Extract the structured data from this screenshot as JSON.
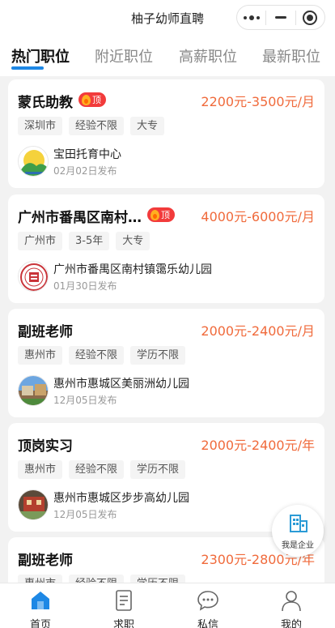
{
  "header": {
    "app_title": "柚子幼师直聘"
  },
  "tabs": [
    {
      "label": "热门职位",
      "active": true
    },
    {
      "label": "附近职位",
      "active": false
    },
    {
      "label": "高薪职位",
      "active": false
    },
    {
      "label": "最新职位",
      "active": false
    }
  ],
  "jobs": [
    {
      "title": "蒙氏助教",
      "badge": "顶",
      "salary": "2200元-3500元/月",
      "tags": [
        "深圳市",
        "经验不限",
        "大专"
      ],
      "company": "宝田托育中心",
      "posted": "02月02日发布"
    },
    {
      "title": "广州市番禺区南村…",
      "badge": "顶",
      "salary": "4000元-6000元/月",
      "tags": [
        "广州市",
        "3-5年",
        "大专"
      ],
      "company": "广州市番禺区南村镇霭乐幼儿园",
      "posted": "01月30日发布"
    },
    {
      "title": "副班老师",
      "badge": "",
      "salary": "2000元-2400元/月",
      "tags": [
        "惠州市",
        "经验不限",
        "学历不限"
      ],
      "company": "惠州市惠城区美丽洲幼儿园",
      "posted": "12月05日发布"
    },
    {
      "title": "顶岗实习",
      "badge": "",
      "salary": "2000元-2400元/年",
      "tags": [
        "惠州市",
        "经验不限",
        "学历不限"
      ],
      "company": "惠州市惠城区步步高幼儿园",
      "posted": "12月05日发布"
    },
    {
      "title": "副班老师",
      "badge": "",
      "salary": "2300元-2800元/年",
      "tags": [
        "惠州市",
        "经验不限",
        "学历不限"
      ],
      "company": "",
      "posted": ""
    }
  ],
  "float_button": {
    "label": "我是企业"
  },
  "bottom_nav": [
    {
      "label": "首页",
      "icon": "home-icon",
      "active": true
    },
    {
      "label": "求职",
      "icon": "document-icon",
      "active": false
    },
    {
      "label": "私信",
      "icon": "chat-bubble-icon",
      "active": false
    },
    {
      "label": "我的",
      "icon": "person-icon",
      "active": false
    }
  ],
  "colors": {
    "accent": "#1e88e5",
    "salary": "#f06a3b",
    "badge": "#f23b3b"
  }
}
